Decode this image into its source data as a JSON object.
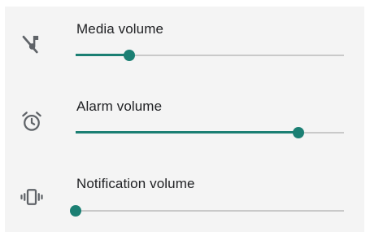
{
  "volumes": [
    {
      "label": "Media volume",
      "icon": "music-off-icon",
      "level": 0.2
    },
    {
      "label": "Alarm volume",
      "icon": "alarm-clock-icon",
      "level": 0.83
    },
    {
      "label": "Notification volume",
      "icon": "vibrate-icon",
      "level": 0.0
    }
  ],
  "colors": {
    "accent": "#1b7f73",
    "track": "#c9c9c9",
    "background": "#f4f4f4"
  }
}
